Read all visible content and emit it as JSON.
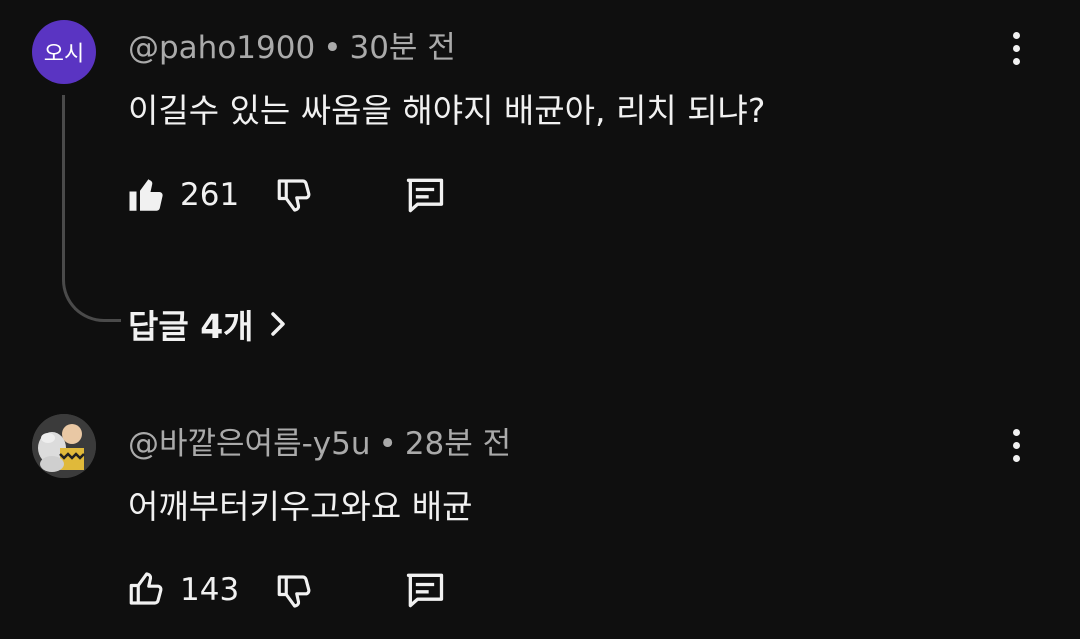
{
  "comments": [
    {
      "avatar_text": "오시",
      "handle": "@paho1900",
      "time": "30분 전",
      "text": "이길수 있는 싸움을 해야지 배균아, 리치 되냐?",
      "likes": "261",
      "liked": true,
      "replies_label": "답글 4개",
      "avatar_color": "#5a34c2"
    },
    {
      "avatar_text": "",
      "handle": "@바깥은여름-y5u",
      "time": "28분 전",
      "text": "어깨부터키우고와요 배균",
      "likes": "143",
      "liked": false
    }
  ],
  "separator": "•",
  "icons": [
    "thumbs-up-icon",
    "thumbs-down-icon",
    "reply-icon",
    "more-vert-icon",
    "chevron-right-icon"
  ]
}
